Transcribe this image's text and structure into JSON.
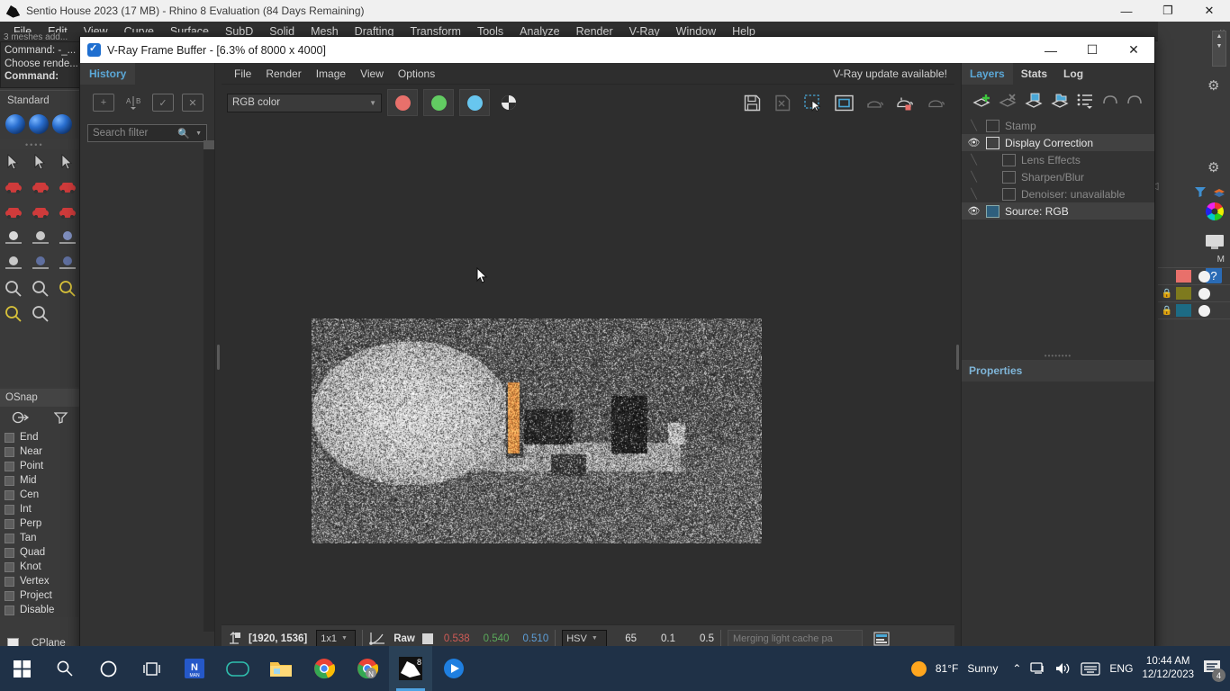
{
  "rhino": {
    "title": "Sentio House 2023 (17 MB) - Rhino 8 Evaluation (84 Days Remaining)",
    "window_buttons": {
      "minimize": "—",
      "maximize": "❐",
      "close": "✕"
    },
    "menu": [
      "File",
      "Edit",
      "View",
      "Curve",
      "Surface",
      "SubD",
      "Solid",
      "Mesh",
      "Drafting",
      "Transform",
      "Tools",
      "Analyze",
      "Render",
      "V-Ray",
      "Window",
      "Help"
    ],
    "command_history": [
      "3 meshes add...",
      "Command: -_...",
      "Choose rende...",
      "Command:"
    ],
    "toolbar_label": "Standard",
    "osnap": {
      "title": "OSnap",
      "items": [
        "End",
        "Near",
        "Point",
        "Mid",
        "Cen",
        "Int",
        "Perp",
        "Tan",
        "Quad",
        "Knot",
        "Vertex",
        "Project",
        "Disable"
      ],
      "cplane": "CPlane"
    },
    "layer_table_header": "M"
  },
  "vfb": {
    "title": "V-Ray Frame Buffer - [6.3% of 8000 x 4000]",
    "window_buttons": {
      "minimize": "—",
      "maximize": "☐",
      "close": "✕"
    },
    "menu": [
      "File",
      "Render",
      "Image",
      "View",
      "Options"
    ],
    "update_notice": "V-Ray update available!",
    "channel_select": "RGB color",
    "history": {
      "tab": "History",
      "search_placeholder": "Search filter",
      "tools": [
        "history-add",
        "history-compare",
        "history-apply",
        "history-delete"
      ]
    },
    "toolbar_icons": [
      "save-image",
      "save-image-disabled",
      "region-render",
      "crop-region",
      "render-last",
      "render-region",
      "render-stop"
    ],
    "statusbar": {
      "pixel_coords": "[1920, 1536]",
      "zoom_level": "1x1",
      "raw_label": "Raw",
      "red": "0.538",
      "green": "0.540",
      "blue": "0.510",
      "color_mode": "HSV",
      "h": "65",
      "s": "0.1",
      "v": "0.5",
      "message": "Merging light cache pa"
    },
    "right_dock": {
      "tabs": [
        "Layers",
        "Stats",
        "Log"
      ],
      "active_tab": "Layers",
      "tools": [
        "add-layer",
        "remove-layer",
        "save-layer",
        "load-layer",
        "layer-menu",
        "undo",
        "redo"
      ],
      "layers": [
        {
          "name": "Stamp",
          "visible": false,
          "indent": 0,
          "enabled": false
        },
        {
          "name": "Display Correction",
          "visible": true,
          "indent": 0,
          "enabled": true
        },
        {
          "name": "Lens Effects",
          "visible": false,
          "indent": 1,
          "enabled": false
        },
        {
          "name": "Sharpen/Blur",
          "visible": false,
          "indent": 1,
          "enabled": false
        },
        {
          "name": "Denoiser: unavailable",
          "visible": false,
          "indent": 1,
          "enabled": false
        },
        {
          "name": "Source: RGB",
          "visible": true,
          "indent": 0,
          "enabled": true
        }
      ],
      "properties_title": "Properties"
    }
  },
  "taskbar": {
    "apps": [
      "start",
      "search",
      "cortana",
      "task-view",
      "n-app",
      "messaging",
      "file-explorer",
      "chrome",
      "chrome-n",
      "rhino",
      "player"
    ],
    "weather_temp": "81°F",
    "weather_desc": "Sunny",
    "language": "ENG",
    "time": "10:44 AM",
    "date": "12/12/2023",
    "notification_count": "4"
  },
  "colors": {
    "accent": "#5ba7d6",
    "taskbar": "#1f3147",
    "red_channel": "#d9534f",
    "green_channel": "#5cb85c",
    "blue_channel": "#5bc0de",
    "weather": "#ffa61e"
  }
}
